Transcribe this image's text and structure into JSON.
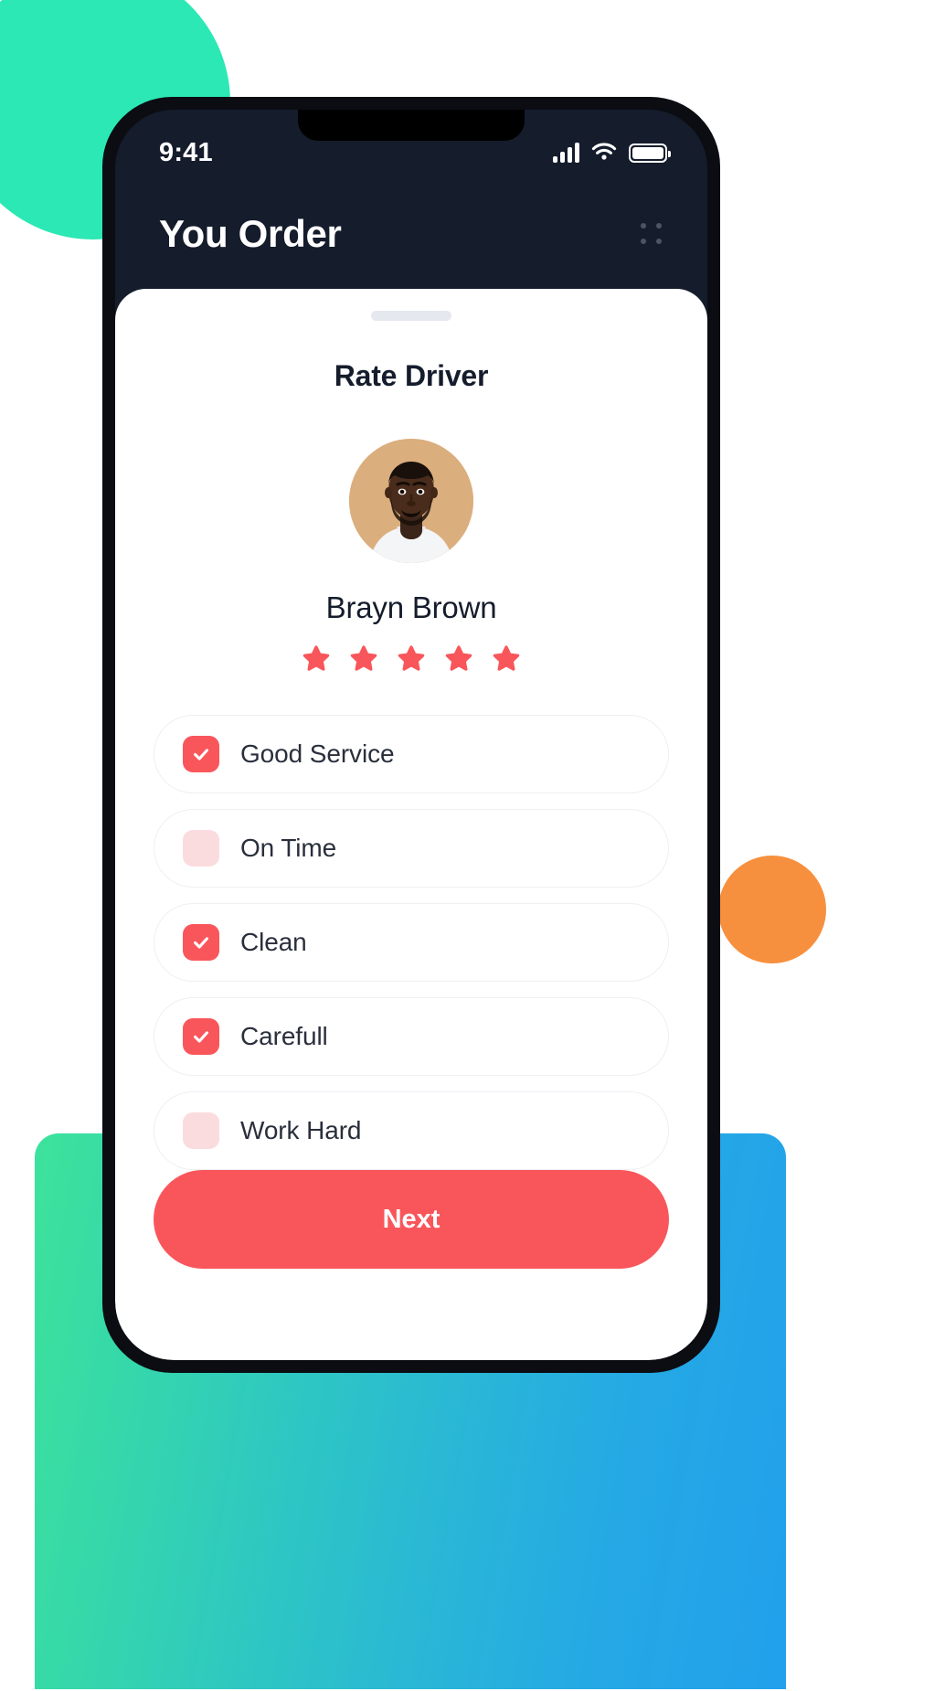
{
  "theme": {
    "accent": "#F9565B",
    "accent_soft": "#FBDCDE",
    "dark": "#151C2C",
    "deco_teal": "#2BE8B4",
    "deco_orange": "#F7903E",
    "deco_gradient_start": "#3DE39B",
    "deco_gradient_end": "#22A0EC"
  },
  "status_bar": {
    "time": "9:41",
    "icons": [
      "signal-bars-icon",
      "wifi-icon",
      "battery-icon"
    ],
    "battery_level": "100"
  },
  "header": {
    "title": "You Order",
    "menu_icon": "grid-dots-icon"
  },
  "sheet": {
    "drag_handle": "drag-handle",
    "title": "Rate Driver",
    "driver": {
      "name": "Brayn Brown",
      "avatar": "driver-avatar",
      "rating": 5,
      "stars_total": 5
    },
    "options": [
      {
        "label": "Good Service",
        "checked": true
      },
      {
        "label": "On Time",
        "checked": false
      },
      {
        "label": "Clean",
        "checked": true
      },
      {
        "label": "Carefull",
        "checked": true
      },
      {
        "label": "Work Hard",
        "checked": false
      }
    ],
    "primary_action": "Next"
  }
}
